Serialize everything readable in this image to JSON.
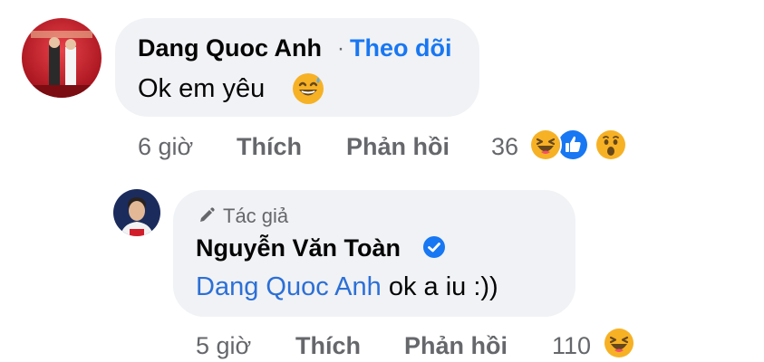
{
  "comment": {
    "author": "Dang Quoc Anh",
    "separator": "·",
    "follow_label": "Theo dõi",
    "text": "Ok em yêu",
    "emoji": "grinning-sweat-emoji",
    "time": "6 giờ",
    "like_label": "Thích",
    "reply_label": "Phản hồi",
    "reaction_count": "36",
    "reactions": [
      "haha",
      "like",
      "wow"
    ]
  },
  "reply": {
    "author_tag": "Tác giả",
    "author": "Nguyễn Văn Toàn",
    "verified": true,
    "mention": "Dang Quoc Anh",
    "text": " ok a iu :))",
    "time": "5 giờ",
    "like_label": "Thích",
    "reply_label": "Phản hồi",
    "reaction_count": "110",
    "reactions": [
      "haha"
    ]
  },
  "colors": {
    "bubble": "#f0f2f5",
    "link": "#1877f2",
    "mention": "#2c6fd6",
    "secondary_text": "#65676b",
    "like_blue": "#1877f2",
    "emoji_yellow": "#f7b125"
  }
}
